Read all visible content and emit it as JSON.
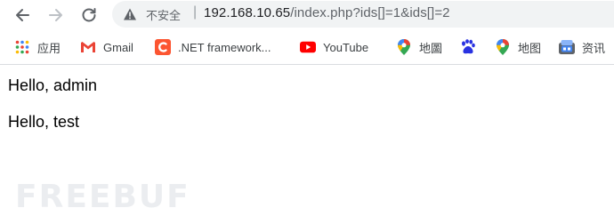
{
  "toolbar": {
    "security_label": "不安全",
    "url_host": "192.168.10.65",
    "url_path": "/index.php?ids[]=1&ids[]=2"
  },
  "bookmarks": [
    {
      "label": "应用",
      "icon": "apps-grid-icon"
    },
    {
      "label": "Gmail",
      "icon": "gmail-icon"
    },
    {
      "label": ".NET framework...",
      "icon": "csdn-icon"
    },
    {
      "label": "YouTube",
      "icon": "youtube-icon"
    },
    {
      "label": "地圖",
      "icon": "maps-pin-icon"
    },
    {
      "label": "",
      "icon": "baidu-paw-icon"
    },
    {
      "label": "地图",
      "icon": "maps-pin-icon"
    },
    {
      "label": "资讯",
      "icon": "news-icon"
    }
  ],
  "page": {
    "lines": [
      "Hello, admin",
      "Hello, test"
    ]
  },
  "watermark": "FREEBUF",
  "colors": {
    "gmail_red": "#ea4335",
    "csdn_orange": "#fc5531",
    "youtube_red": "#ff0000",
    "baidu_blue": "#2932e1"
  }
}
